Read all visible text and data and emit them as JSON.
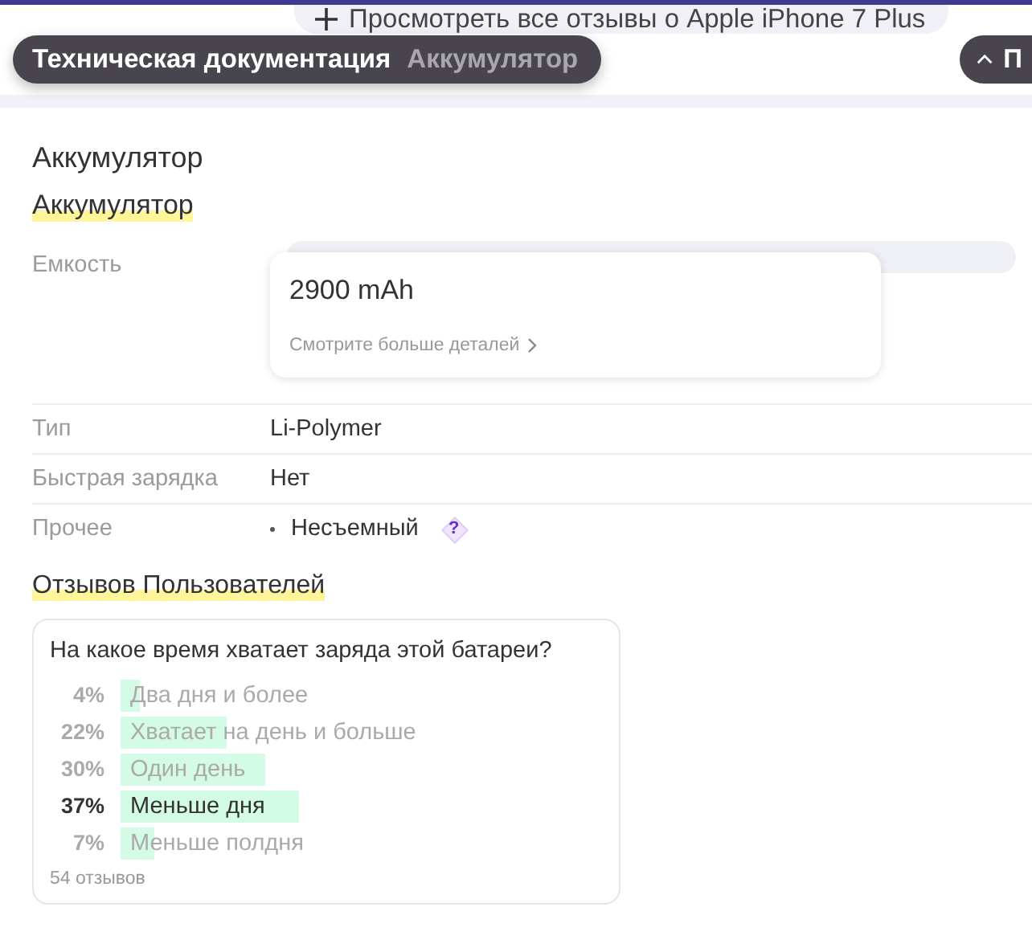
{
  "top_bar": {
    "all_reviews_link": "Просмотреть все отзывы о Apple iPhone 7 Plus",
    "breadcrumb": {
      "section": "Техническая документация",
      "current": "Аккумулятор"
    },
    "collapse_button": "П"
  },
  "section_title": "Аккумулятор",
  "group_title": "Аккумулятор",
  "specs": [
    {
      "kind": "card",
      "label": "Емкость",
      "value": "2900 mAh",
      "link": "Смотрите больше деталей"
    },
    {
      "kind": "text",
      "label": "Тип",
      "value": "Li-Polymer"
    },
    {
      "kind": "text",
      "label": "Быстрая зарядка",
      "value": "Нет"
    },
    {
      "kind": "list",
      "label": "Прочее",
      "items": [
        {
          "text": "Несъемный",
          "help": "?"
        }
      ]
    }
  ],
  "reviews": {
    "title": "Отзывов Пользователей",
    "question": "На какое время хватает заряда этой батареи?",
    "options": [
      {
        "percent": "4%",
        "label": "Два дня и более",
        "leading": false
      },
      {
        "percent": "22%",
        "label": "Хватает на день и больше",
        "leading": false
      },
      {
        "percent": "30%",
        "label": "Один день",
        "leading": false
      },
      {
        "percent": "37%",
        "label": "Меньше дня",
        "leading": true
      },
      {
        "percent": "7%",
        "label": "Меньше полдня",
        "leading": false
      }
    ],
    "count": "54 отзывов"
  }
}
